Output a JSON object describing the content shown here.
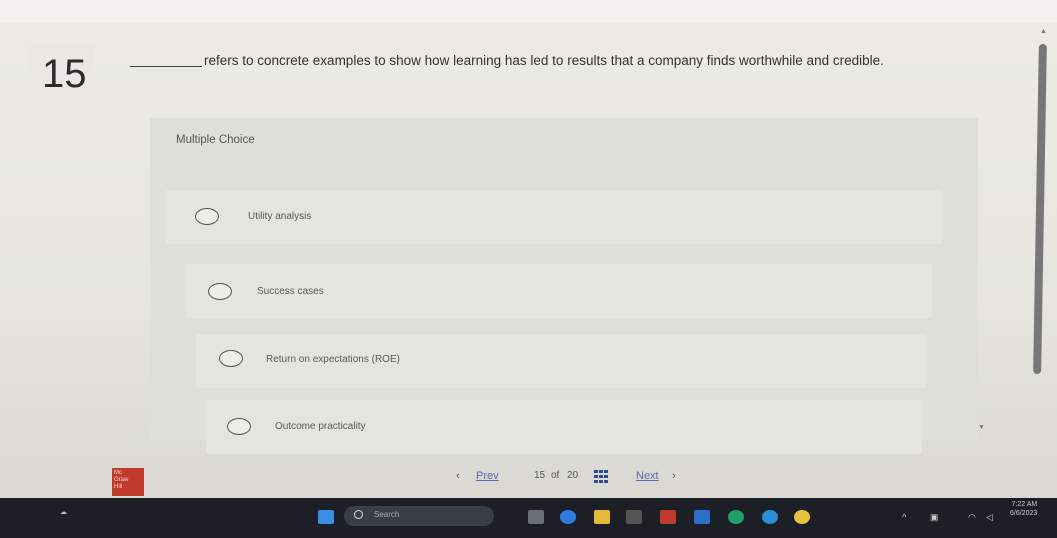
{
  "question": {
    "number": "15",
    "text": "refers to concrete examples to show how learning has led to results that a company finds worthwhile and credible."
  },
  "multiple_choice": {
    "label": "Multiple Choice",
    "options": [
      {
        "label": "Utility analysis"
      },
      {
        "label": "Success cases"
      },
      {
        "label": "Return on expectations (ROE)"
      },
      {
        "label": "Outcome practicality"
      }
    ]
  },
  "pager": {
    "prev_label": "Prev",
    "current": "15",
    "of_label": "of",
    "total": "20",
    "next_label": "Next"
  },
  "taskbar": {
    "search_placeholder": "Search",
    "time": "7:22 AM",
    "date": "6/6/2023"
  },
  "colors": {
    "link": "#5b6bb0",
    "logo": "#c0392b",
    "taskbar": "#1c1f26"
  }
}
